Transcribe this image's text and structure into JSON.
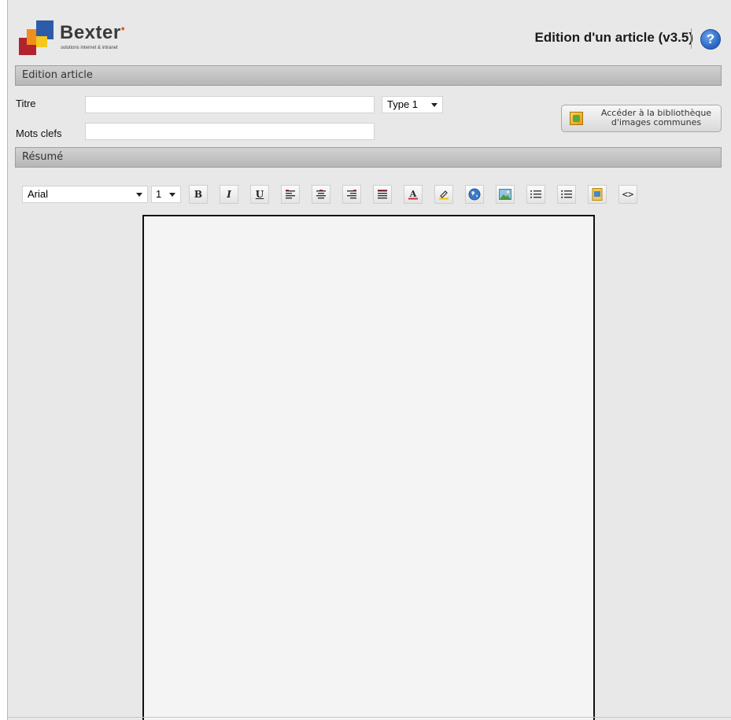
{
  "brand": {
    "name": "Bexter",
    "tagline": "solutions internet & intranet"
  },
  "header": {
    "title": "Edition d'un article (v3.5)",
    "help_symbol": "?"
  },
  "sections": {
    "edition": "Edition article",
    "resume": "Résumé"
  },
  "form": {
    "title_label": "Titre",
    "title_value": "",
    "keywords_label": "Mots clefs",
    "keywords_value": "",
    "type_selected": "Type 1",
    "library_button_line1": "Accéder à la bibliothèque",
    "library_button_line2": "d'images communes"
  },
  "toolbar": {
    "font_selected": "Arial",
    "size_selected": "1",
    "buttons": [
      {
        "name": "bold",
        "icon": "bold-icon",
        "glyph": "B"
      },
      {
        "name": "italic",
        "icon": "italic-icon",
        "glyph": "I"
      },
      {
        "name": "underline",
        "icon": "underline-icon",
        "glyph": "U"
      },
      {
        "name": "align-left",
        "icon": "align-left-icon"
      },
      {
        "name": "align-center",
        "icon": "align-center-icon"
      },
      {
        "name": "align-right",
        "icon": "align-right-icon"
      },
      {
        "name": "align-justify",
        "icon": "align-justify-icon"
      },
      {
        "name": "text-color",
        "icon": "text-color-icon",
        "glyph": "A"
      },
      {
        "name": "highlight",
        "icon": "highlight-icon"
      },
      {
        "name": "insert-link",
        "icon": "globe-icon"
      },
      {
        "name": "insert-image",
        "icon": "image-icon"
      },
      {
        "name": "ordered-list",
        "icon": "ordered-list-icon"
      },
      {
        "name": "unordered-list",
        "icon": "unordered-list-icon"
      },
      {
        "name": "insert-document",
        "icon": "document-icon"
      },
      {
        "name": "source-code",
        "icon": "code-icon",
        "glyph": "<>"
      }
    ]
  },
  "colors": {
    "background": "#e8e8e8",
    "section_bar": "#c4c4c4",
    "help_blue": "#2f6bc8",
    "logo_red": "#b1242d",
    "logo_orange": "#f18e1c",
    "logo_blue": "#2d5ba8",
    "logo_yellow": "#f4c81d"
  }
}
